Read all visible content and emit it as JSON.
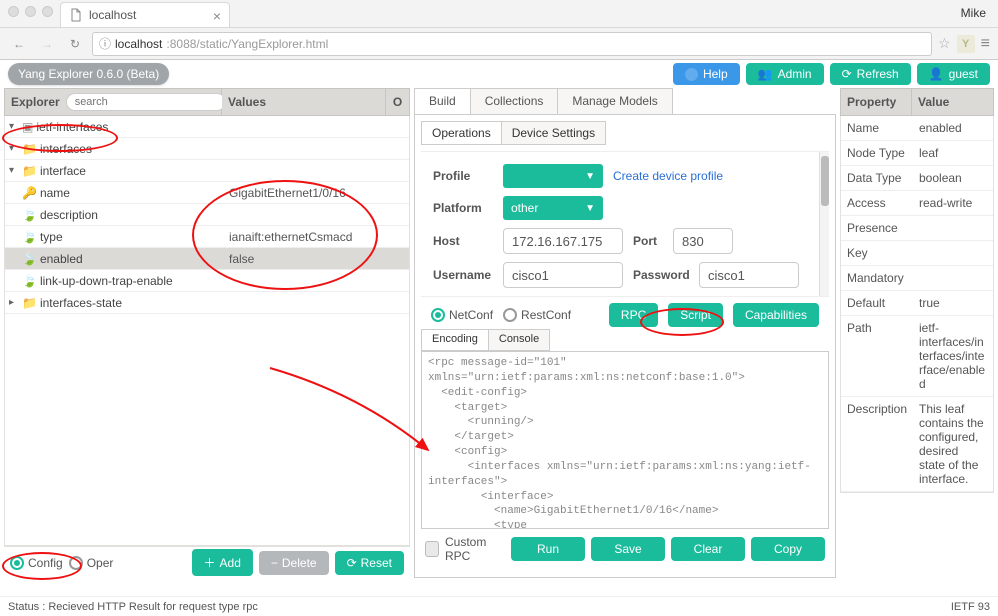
{
  "browser": {
    "tab_title": "localhost",
    "user": "Mike",
    "url_bold": "localhost",
    "url_rest": ":8088/static/YangExplorer.html"
  },
  "app": {
    "beta": "Yang Explorer 0.6.0 (Beta)",
    "help": "Help",
    "admin": "Admin",
    "refresh": "Refresh",
    "guest": "guest"
  },
  "explorer": {
    "header_name": "Explorer",
    "header_values": "Values",
    "header_op": "O",
    "search_placeholder": "search",
    "rows": [
      {
        "indent": 0,
        "twist": "▾",
        "icon": "module",
        "label": "ietf-interfaces",
        "value": "",
        "sel": false
      },
      {
        "indent": 1,
        "twist": "▾",
        "icon": "folder",
        "label": "interfaces",
        "value": "",
        "sel": false
      },
      {
        "indent": 2,
        "twist": "▾",
        "icon": "folder",
        "label": "interface",
        "value": "",
        "sel": false
      },
      {
        "indent": 3,
        "twist": "",
        "icon": "key",
        "label": "name",
        "value": "GigabitEthernet1/0/16",
        "sel": false
      },
      {
        "indent": 3,
        "twist": "",
        "icon": "leafg",
        "label": "description",
        "value": "",
        "sel": false
      },
      {
        "indent": 3,
        "twist": "",
        "icon": "leafr",
        "label": "type",
        "value": "ianaift:ethernetCsmacd",
        "sel": false
      },
      {
        "indent": 3,
        "twist": "",
        "icon": "leafg",
        "label": "enabled",
        "value": "false",
        "sel": true
      },
      {
        "indent": 3,
        "twist": "",
        "icon": "leafg",
        "label": "link-up-down-trap-enable",
        "value": "",
        "sel": false
      },
      {
        "indent": 1,
        "twist": "▸",
        "icon": "folder",
        "label": "interfaces-state",
        "value": "",
        "sel": false
      }
    ],
    "foot": {
      "config": "Config",
      "oper": "Oper",
      "add": "Add",
      "del": "Delete",
      "reset": "Reset"
    }
  },
  "mid": {
    "tabs": {
      "build": "Build",
      "collections": "Collections",
      "models": "Manage Models"
    },
    "subtabs": {
      "ops": "Operations",
      "dev": "Device Settings"
    },
    "profile_label": "Profile",
    "profile_value": "",
    "create_profile": "Create device profile",
    "platform_label": "Platform",
    "platform_value": "other",
    "host_label": "Host",
    "host_value": "172.16.167.175",
    "port_label": "Port",
    "port_value": "830",
    "user_label": "Username",
    "user_value": "cisco1",
    "pass_label": "Password",
    "pass_value": "cisco1",
    "netconf": "NetConf",
    "restconf": "RestConf",
    "rpc": "RPC",
    "script": "Script",
    "caps": "Capabilities",
    "enc_tab": "Encoding",
    "console_tab": "Console",
    "console_text": "<rpc message-id=\"101\"\nxmlns=\"urn:ietf:params:xml:ns:netconf:base:1.0\">\n  <edit-config>\n    <target>\n      <running/>\n    </target>\n    <config>\n      <interfaces xmlns=\"urn:ietf:params:xml:ns:yang:ietf-interfaces\">\n        <interface>\n          <name>GigabitEthernet1/0/16</name>\n          <type xmlns:ianaift=\"urn:ietf:params:xml:ns:yang:iana-if-type\">ianaift:ethernetCsmacd</type>\n          <enabled>false</enabled>\n        </interface>",
    "custom": "Custom RPC",
    "run": "Run",
    "save": "Save",
    "clear": "Clear",
    "copy": "Copy"
  },
  "props": {
    "h1": "Property",
    "h2": "Value",
    "rows": [
      {
        "k": "Name",
        "v": "enabled"
      },
      {
        "k": "Node Type",
        "v": "leaf"
      },
      {
        "k": "Data Type",
        "v": "boolean"
      },
      {
        "k": "Access",
        "v": "read-write"
      },
      {
        "k": "Presence",
        "v": ""
      },
      {
        "k": "Key",
        "v": ""
      },
      {
        "k": "Mandatory",
        "v": ""
      },
      {
        "k": "Default",
        "v": "true"
      },
      {
        "k": "Path",
        "v": "ietf-interfaces/interfaces/interface/enabled"
      },
      {
        "k": "Description",
        "v": "This leaf contains the configured, desired state of the interface."
      }
    ]
  },
  "status": {
    "left": "Status : Recieved HTTP Result for request type rpc",
    "right": "IETF 93"
  }
}
